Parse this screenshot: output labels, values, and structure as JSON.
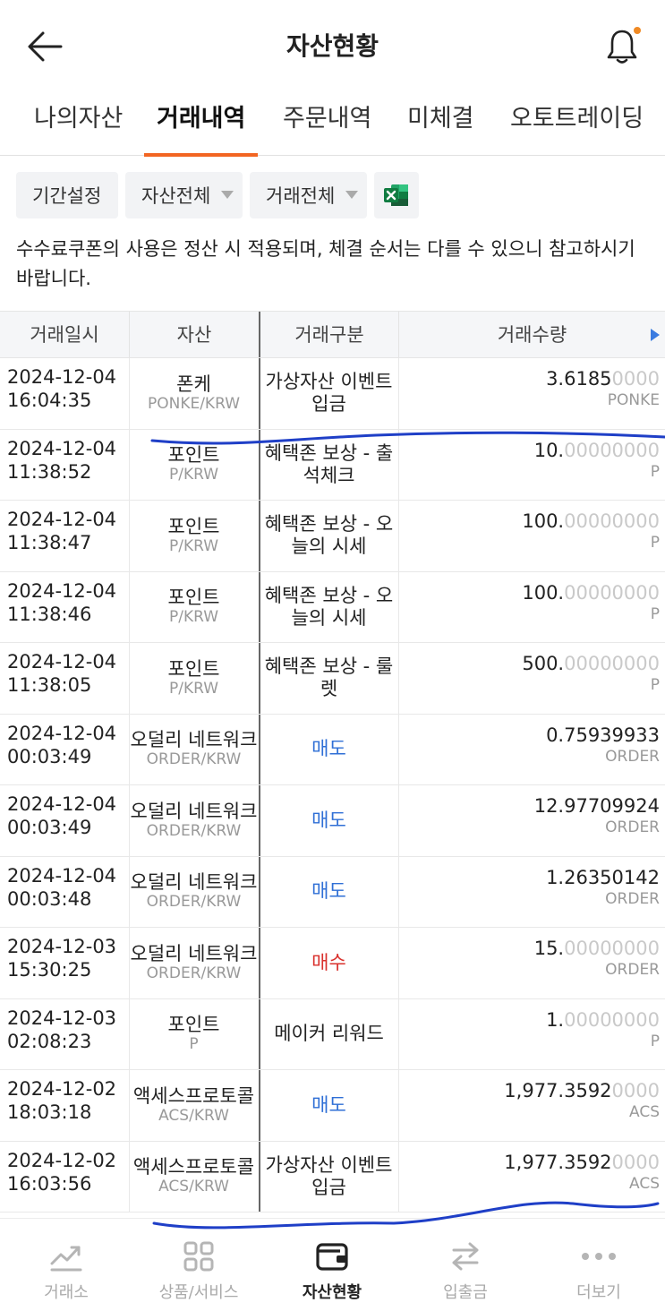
{
  "header": {
    "title": "자산현황"
  },
  "tabs": [
    {
      "label": "나의자산"
    },
    {
      "label": "거래내역"
    },
    {
      "label": "주문내역"
    },
    {
      "label": "미체결"
    },
    {
      "label": "오토트레이딩"
    }
  ],
  "active_tab": "거래내역",
  "filters": {
    "period": "기간설정",
    "asset": "자산전체",
    "trade": "거래전체"
  },
  "notice": "수수료쿠폰의 사용은 정산 시 적용되며, 체결 순서는 다를 수 있으니 참고하시기 바랍니다.",
  "table": {
    "headers": [
      "거래일시",
      "자산",
      "거래구분",
      "거래수량"
    ],
    "rows": [
      {
        "date": "2024-12-04",
        "time": "16:04:35",
        "asset": "폰케",
        "symbol": "PONKE/KRW",
        "type": "가상자산 이벤트 입금",
        "kind": "normal",
        "qty_main": "3.6185",
        "qty_dim": "0000",
        "unit": "PONKE"
      },
      {
        "date": "2024-12-04",
        "time": "11:38:52",
        "asset": "포인트",
        "symbol": "P/KRW",
        "type": "혜택존 보상 - 출석체크",
        "kind": "normal",
        "qty_main": "10.",
        "qty_dim": "00000000",
        "unit": "P"
      },
      {
        "date": "2024-12-04",
        "time": "11:38:47",
        "asset": "포인트",
        "symbol": "P/KRW",
        "type": "혜택존 보상 - 오늘의 시세",
        "kind": "normal",
        "qty_main": "100.",
        "qty_dim": "00000000",
        "unit": "P"
      },
      {
        "date": "2024-12-04",
        "time": "11:38:46",
        "asset": "포인트",
        "symbol": "P/KRW",
        "type": "혜택존 보상 - 오늘의 시세",
        "kind": "normal",
        "qty_main": "100.",
        "qty_dim": "00000000",
        "unit": "P"
      },
      {
        "date": "2024-12-04",
        "time": "11:38:05",
        "asset": "포인트",
        "symbol": "P/KRW",
        "type": "혜택존 보상 - 룰렛",
        "kind": "normal",
        "qty_main": "500.",
        "qty_dim": "00000000",
        "unit": "P"
      },
      {
        "date": "2024-12-04",
        "time": "00:03:49",
        "asset": "오덜리 네트워크",
        "symbol": "ORDER/KRW",
        "type": "매도",
        "kind": "sell",
        "qty_main": "0.75939933",
        "qty_dim": "",
        "unit": "ORDER"
      },
      {
        "date": "2024-12-04",
        "time": "00:03:49",
        "asset": "오덜리 네트워크",
        "symbol": "ORDER/KRW",
        "type": "매도",
        "kind": "sell",
        "qty_main": "12.97709924",
        "qty_dim": "",
        "unit": "ORDER"
      },
      {
        "date": "2024-12-04",
        "time": "00:03:48",
        "asset": "오덜리 네트워크",
        "symbol": "ORDER/KRW",
        "type": "매도",
        "kind": "sell",
        "qty_main": "1.26350142",
        "qty_dim": "",
        "unit": "ORDER"
      },
      {
        "date": "2024-12-03",
        "time": "15:30:25",
        "asset": "오덜리 네트워크",
        "symbol": "ORDER/KRW",
        "type": "매수",
        "kind": "buy",
        "qty_main": "15.",
        "qty_dim": "00000000",
        "unit": "ORDER"
      },
      {
        "date": "2024-12-03",
        "time": "02:08:23",
        "asset": "포인트",
        "symbol": "P",
        "type": "메이커 리워드",
        "kind": "normal",
        "qty_main": "1.",
        "qty_dim": "00000000",
        "unit": "P"
      },
      {
        "date": "2024-12-02",
        "time": "18:03:18",
        "asset": "액세스프로토콜",
        "symbol": "ACS/KRW",
        "type": "매도",
        "kind": "sell",
        "qty_main": "1,977.3592",
        "qty_dim": "0000",
        "unit": "ACS"
      },
      {
        "date": "2024-12-02",
        "time": "16:03:56",
        "asset": "액세스프로토콜",
        "symbol": "ACS/KRW",
        "type": "가상자산 이벤트 입금",
        "kind": "normal",
        "qty_main": "1,977.3592",
        "qty_dim": "0000",
        "unit": "ACS"
      }
    ]
  },
  "bottom_nav": [
    {
      "label": "거래소",
      "icon": "chart-line-icon"
    },
    {
      "label": "상품/서비스",
      "icon": "grid-icon"
    },
    {
      "label": "자산현황",
      "icon": "wallet-icon"
    },
    {
      "label": "입출금",
      "icon": "transfer-arrows-icon"
    },
    {
      "label": "더보기",
      "icon": "more-dots-icon"
    }
  ],
  "active_nav": "자산현황",
  "colors": {
    "accent": "#f26522",
    "sell": "#2f6fd6",
    "buy": "#d9302c",
    "notification_dot": "#f08a24",
    "excel_green": "#1e7145",
    "annotation_stroke": "#1f3fc7"
  }
}
